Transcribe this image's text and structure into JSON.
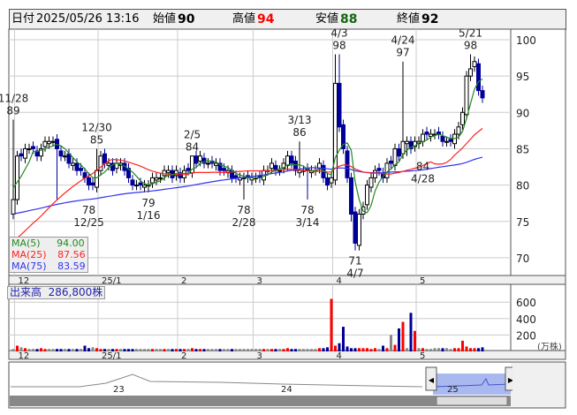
{
  "header": {
    "date_label": "日付",
    "date": "2025/05/26 13:16",
    "open_label": "始値",
    "open": "90",
    "high_label": "高値",
    "high": "94",
    "low_label": "安値",
    "low": "88",
    "close_label": "終値",
    "close": "92"
  },
  "colors": {
    "up": "#ff0000",
    "down": "#000099",
    "flat": "#888888",
    "ma5": "#228822",
    "ma25": "#ff2222",
    "ma75": "#3333ee",
    "high": "#ff0000",
    "low": "#116611"
  },
  "legend": {
    "ma5_label": "MA(5)",
    "ma5": "94.00",
    "ma25_label": "MA(25)",
    "ma25": "87.56",
    "ma75_label": "MA(75)",
    "ma75": "83.59"
  },
  "volume_legend": {
    "label": "出来高",
    "value": "286,800株"
  },
  "volume_unit": "(万株)",
  "navigator": {
    "labels": [
      "23",
      "24",
      "25"
    ]
  },
  "chart_data": {
    "type": "candlestick",
    "price_ticks": [
      100,
      95,
      90,
      85,
      80,
      75,
      70
    ],
    "price_range": [
      68,
      101
    ],
    "volume_ticks": [
      600,
      400,
      200
    ],
    "volume_range": [
      0,
      700
    ],
    "month_labels": [
      {
        "index": 1,
        "label": "12"
      },
      {
        "index": 22,
        "label": "25/1"
      },
      {
        "index": 42,
        "label": "2"
      },
      {
        "index": 61,
        "label": "3"
      },
      {
        "index": 81,
        "label": "4"
      },
      {
        "index": 102,
        "label": "5"
      }
    ],
    "closes": [
      78,
      84,
      84,
      85,
      85,
      85,
      84,
      85,
      86,
      86,
      86,
      85,
      84,
      84,
      83,
      83,
      82,
      82,
      81,
      80,
      80,
      82,
      84,
      83,
      83,
      82,
      83,
      83,
      82,
      81,
      80,
      80,
      80,
      80,
      80,
      81,
      81,
      81,
      82,
      82,
      81,
      82,
      81,
      82,
      82,
      84,
      83,
      84,
      83,
      83,
      83,
      83,
      82,
      82,
      82,
      81,
      81,
      81,
      81,
      81,
      81,
      81,
      81,
      82,
      82,
      83,
      82,
      82,
      83,
      84,
      83,
      82,
      82,
      82,
      82,
      82,
      82,
      83,
      81,
      80,
      81,
      94,
      88,
      85,
      81,
      76,
      72,
      76,
      77,
      80,
      81,
      82,
      82,
      81,
      83,
      83,
      85,
      84,
      86,
      86,
      85,
      86,
      86,
      87,
      87,
      87,
      87,
      87,
      86,
      86,
      86,
      87,
      88,
      90,
      95,
      96,
      97,
      93,
      92
    ],
    "highs": {
      "0": 89,
      "21": 85,
      "45": 84,
      "72": 86,
      "81": 98,
      "82": 98,
      "98": 97,
      "115": 98
    },
    "lows": {
      "11": 78,
      "34": 79,
      "58": 78,
      "74": 78,
      "85": 75,
      "86": 71,
      "99": 84
    },
    "volumes": [
      30,
      70,
      50,
      40,
      30,
      30,
      30,
      40,
      30,
      30,
      30,
      30,
      30,
      30,
      30,
      30,
      30,
      30,
      70,
      40,
      50,
      40,
      30,
      30,
      30,
      30,
      30,
      30,
      30,
      30,
      30,
      30,
      30,
      30,
      30,
      30,
      30,
      30,
      30,
      30,
      30,
      30,
      30,
      30,
      30,
      40,
      30,
      30,
      30,
      30,
      30,
      30,
      30,
      30,
      30,
      30,
      30,
      30,
      30,
      30,
      30,
      30,
      30,
      30,
      30,
      30,
      30,
      30,
      30,
      40,
      30,
      30,
      30,
      30,
      30,
      30,
      30,
      40,
      40,
      50,
      640,
      70,
      100,
      300,
      60,
      40,
      40,
      40,
      40,
      40,
      30,
      40,
      30,
      70,
      40,
      200,
      80,
      280,
      360,
      40,
      470,
      250,
      40,
      40,
      30,
      30,
      40,
      40,
      40,
      40,
      30,
      40,
      40,
      130,
      60,
      40,
      40,
      40,
      50
    ],
    "annotations": [
      {
        "index": 0,
        "price": 89,
        "date": "11/28",
        "pos": "above"
      },
      {
        "index": 21,
        "price": 85,
        "date": "12/30",
        "pos": "above"
      },
      {
        "index": 45,
        "price": 84,
        "date": "2/5",
        "pos": "above"
      },
      {
        "index": 72,
        "price": 86,
        "date": "3/13",
        "pos": "above"
      },
      {
        "index": 82,
        "price": 98,
        "date": "4/3",
        "pos": "above"
      },
      {
        "index": 98,
        "price": 97,
        "date": "4/24",
        "pos": "above"
      },
      {
        "index": 115,
        "price": 98,
        "date": "5/21",
        "pos": "above"
      },
      {
        "index": 19,
        "price": 78,
        "date": "12/25",
        "pos": "below"
      },
      {
        "index": 34,
        "price": 79,
        "date": "1/16",
        "pos": "below"
      },
      {
        "index": 58,
        "price": 78,
        "date": "2/28",
        "pos": "below"
      },
      {
        "index": 74,
        "price": 78,
        "date": "3/14",
        "pos": "below"
      },
      {
        "index": 86,
        "price": 71,
        "date": "4/7",
        "pos": "below"
      },
      {
        "index": 103,
        "price": 84,
        "date": "4/28",
        "pos": "below"
      }
    ]
  }
}
